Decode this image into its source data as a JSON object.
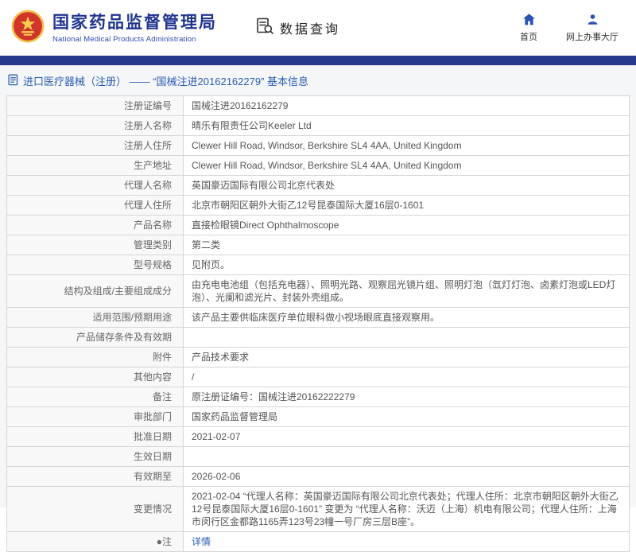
{
  "header": {
    "org_cn": "国家药品监督管理局",
    "org_en": "National Medical Products Administration",
    "query_label": "数据查询",
    "nav": [
      {
        "label": "首页",
        "icon": "home-icon"
      },
      {
        "label": "网上办事大厅",
        "icon": "person-icon"
      }
    ]
  },
  "breadcrumb": {
    "text": "进口医疗器械（注册） ——  “国械注进20162162279” 基本信息"
  },
  "colors": {
    "topbar_blue": "#24398e",
    "title_blue": "#1f3492",
    "link_blue": "#2a5db4",
    "emblem_red": "#d3342a",
    "emblem_gold": "#f0c24a"
  },
  "table": {
    "rows": [
      {
        "label": "注册证编号",
        "value": "国械注进20162162279"
      },
      {
        "label": "注册人名称",
        "value": "晴乐有限责任公司Keeler Ltd"
      },
      {
        "label": "注册人住所",
        "value": "Clewer Hill Road, Windsor, Berkshire SL4 4AA, United Kingdom"
      },
      {
        "label": "生产地址",
        "value": "Clewer Hill Road, Windsor, Berkshire SL4 4AA, United Kingdom"
      },
      {
        "label": "代理人名称",
        "value": "英国豪迈国际有限公司北京代表处"
      },
      {
        "label": "代理人住所",
        "value": "北京市朝阳区朝外大街乙12号昆泰国际大厦16层0-1601"
      },
      {
        "label": "产品名称",
        "value": "直接检眼镜Direct Ophthalmoscope"
      },
      {
        "label": "管理类别",
        "value": "第二类"
      },
      {
        "label": "型号规格",
        "value": "见附页。"
      },
      {
        "label": "结构及组成/主要组成成分",
        "value": "由充电电池组（包括充电器）、照明光路、观察屈光镜片组、照明灯泡（氙灯灯泡、卤素灯泡或LED灯泡）、光阑和滤光片、封装外壳组成。"
      },
      {
        "label": "适用范围/预期用途",
        "value": "该产品主要供临床医疗单位眼科做小视场眼底直接观察用。"
      },
      {
        "label": "产品储存条件及有效期",
        "value": ""
      },
      {
        "label": "附件",
        "value": "产品技术要求"
      },
      {
        "label": "其他内容",
        "value": "/"
      },
      {
        "label": "备注",
        "value": "原注册证编号：国械注进20162222279"
      },
      {
        "label": "审批部门",
        "value": "国家药品监督管理局"
      },
      {
        "label": "批准日期",
        "value": "2021-02-07"
      },
      {
        "label": "生效日期",
        "value": ""
      },
      {
        "label": "有效期至",
        "value": "2026-02-06"
      },
      {
        "label": "变更情况",
        "value": "2021-02-04 “代理人名称：英国豪迈国际有限公司北京代表处；代理人住所：北京市朝阳区朝外大街乙12号昆泰国际大厦16层0-1601” 变更为 “代理人名称：沃迈（上海）机电有限公司；代理人住所：上海市闵行区金都路1165弄123号23幢一号厂房三层B座”。"
      },
      {
        "label": "●注",
        "value": "详情",
        "link": true
      }
    ]
  }
}
